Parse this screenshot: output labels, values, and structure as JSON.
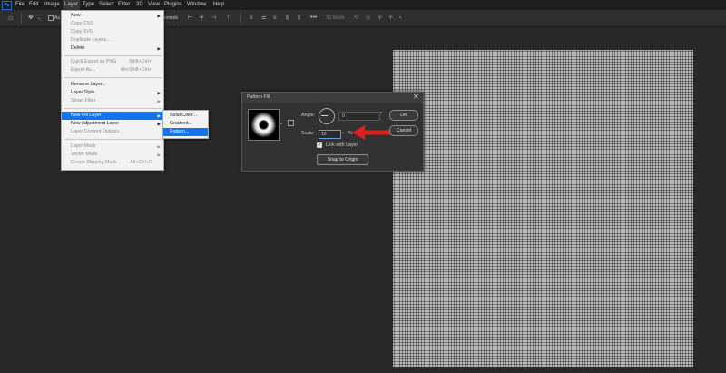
{
  "app": {
    "logo": "Ps"
  },
  "menubar": {
    "items": [
      "File",
      "Edit",
      "Image",
      "Layer",
      "Type",
      "Select",
      "Filter",
      "3D",
      "View",
      "Plugins",
      "Window",
      "Help"
    ]
  },
  "optionsbar": {
    "auto_label": "Au",
    "controls_label": "ontrols",
    "mode_3d": "3D Mode:"
  },
  "layer_menu": {
    "items": [
      {
        "label": "New",
        "shortcut": "",
        "submenu": true,
        "disabled": false
      },
      {
        "label": "Copy CSS",
        "shortcut": "",
        "submenu": false,
        "disabled": true
      },
      {
        "label": "Copy SVG",
        "shortcut": "",
        "submenu": false,
        "disabled": true
      },
      {
        "label": "Duplicate Layers...",
        "shortcut": "",
        "submenu": false,
        "disabled": true
      },
      {
        "label": "Delete",
        "shortcut": "",
        "submenu": true,
        "disabled": false
      },
      {
        "label": "Quick Export as PNG",
        "shortcut": "Shift+Ctrl+'",
        "submenu": false,
        "disabled": true
      },
      {
        "label": "Export As...",
        "shortcut": "Alt+Shift+Ctrl+'",
        "submenu": false,
        "disabled": true
      },
      {
        "label": "Rename Layer...",
        "shortcut": "",
        "submenu": false,
        "disabled": false
      },
      {
        "label": "Layer Style",
        "shortcut": "",
        "submenu": true,
        "disabled": false
      },
      {
        "label": "Smart Filter",
        "shortcut": "",
        "submenu": true,
        "disabled": true
      },
      {
        "label": "New Fill Layer",
        "shortcut": "",
        "submenu": true,
        "disabled": false,
        "highlighted": true
      },
      {
        "label": "New Adjustment Layer",
        "shortcut": "",
        "submenu": true,
        "disabled": false
      },
      {
        "label": "Layer Content Options...",
        "shortcut": "",
        "submenu": false,
        "disabled": true
      },
      {
        "label": "Layer Mask",
        "shortcut": "",
        "submenu": true,
        "disabled": true
      },
      {
        "label": "Vector Mask",
        "shortcut": "",
        "submenu": true,
        "disabled": true
      },
      {
        "label": "Create Clipping Mask",
        "shortcut": "Alt+Ctrl+G",
        "submenu": false,
        "disabled": true
      }
    ]
  },
  "fill_submenu": {
    "items": [
      {
        "label": "Solid Color...",
        "highlighted": false
      },
      {
        "label": "Gradient...",
        "highlighted": false
      },
      {
        "label": "Pattern...",
        "highlighted": true
      }
    ]
  },
  "dialog": {
    "title": "Pattern Fill",
    "angle_label": "Angle:",
    "angle_value": "0",
    "angle_unit": "°",
    "scale_label": "Scale:",
    "scale_value": "10",
    "scale_unit": "%",
    "link_label": "Link with Layer",
    "link_checked": true,
    "snap_button": "Snap to Origin",
    "ok_button": "OK",
    "cancel_button": "Cancel"
  },
  "colors": {
    "accent": "#1473e6",
    "annotation_arrow": "#e02020"
  }
}
